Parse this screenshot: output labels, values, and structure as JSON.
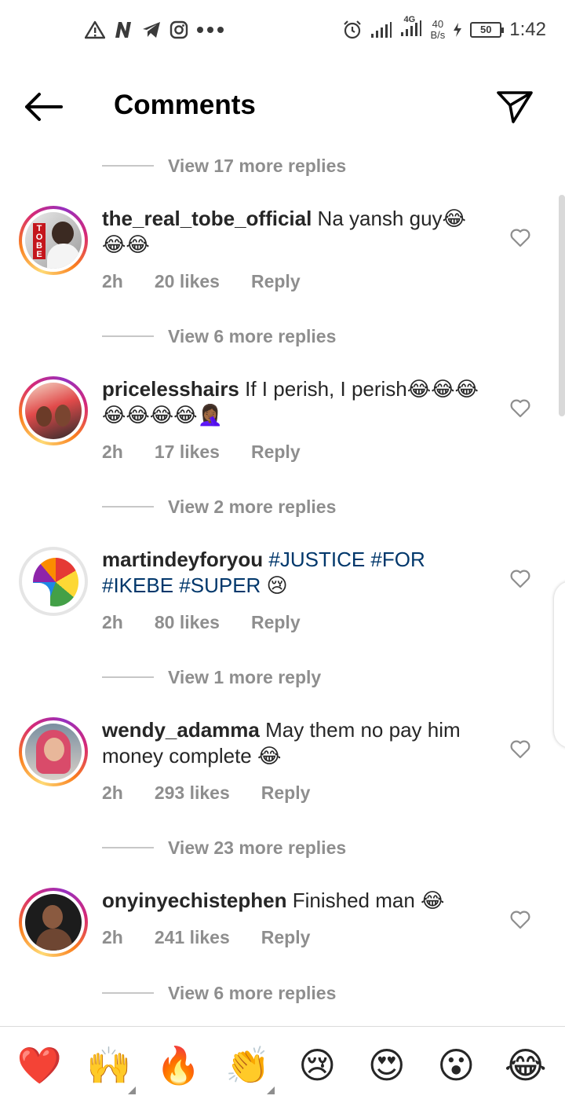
{
  "status_bar": {
    "left_icons": [
      "warning-icon",
      "n-icon",
      "telegram-icon",
      "instagram-icon",
      "more-icon"
    ],
    "network": "4G",
    "speed_value": "40",
    "speed_unit": "B/s",
    "battery": "50",
    "time": "1:42"
  },
  "header": {
    "title": "Comments"
  },
  "replies": [
    "View 17 more replies",
    "View 6 more replies",
    "View 2 more replies",
    "View 1 more reply",
    "View 23 more replies",
    "View 6 more replies"
  ],
  "comments": [
    {
      "username": "the_real_tobe_official",
      "text": "Na yansh guy😂😂😂",
      "time": "2h",
      "likes": "20 likes",
      "reply": "Reply",
      "avatar_label": "TOBE"
    },
    {
      "username": "pricelesshairs",
      "text": "If I perish, I perish😂😂😂😂😂😂😂🤦🏾‍♀️",
      "time": "2h",
      "likes": "17 likes",
      "reply": "Reply"
    },
    {
      "username": "martindeyforyou",
      "text": "",
      "hashtags": "#JUSTICE #FOR #IKEBE #SUPER",
      "trailing": "😢",
      "time": "2h",
      "likes": "80 likes",
      "reply": "Reply"
    },
    {
      "username": "wendy_adamma",
      "text": "May them no pay him money complete 😂",
      "time": "2h",
      "likes": "293 likes",
      "reply": "Reply"
    },
    {
      "username": "onyinyechistephen",
      "text": "Finished man 😂",
      "time": "2h",
      "likes": "241 likes",
      "reply": "Reply"
    }
  ],
  "emoji_bar": [
    "❤️",
    "🙌",
    "🔥",
    "👏",
    "😢",
    "😍",
    "😮",
    "😂"
  ]
}
